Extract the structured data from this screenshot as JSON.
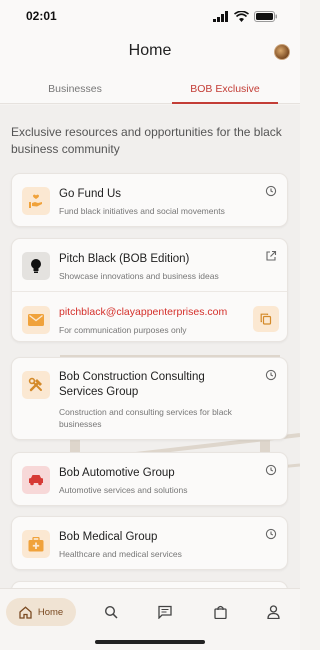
{
  "status": {
    "time": "02:01"
  },
  "header": {
    "title": "Home"
  },
  "tabs": [
    {
      "label": "Businesses",
      "active": false
    },
    {
      "label": "BOB Exclusive",
      "active": true
    }
  ],
  "intro": "Exclusive resources and opportunities for the black business community",
  "cards": {
    "gofund": {
      "title": "Go Fund Us",
      "subtitle": "Fund black initiatives and social movements",
      "icon": "hand-heart-icon"
    },
    "pitch": {
      "title": "Pitch Black (BOB Edition)",
      "subtitle": "Showcase innovations and business ideas",
      "icon": "lightbulb-icon",
      "email": "pitchblack@clayappenterprises.com",
      "email_note": "For communication purposes only"
    },
    "construction": {
      "title": "Bob Construction Consulting Services Group",
      "subtitle": "Construction and consulting services for black businesses",
      "icon": "tools-icon"
    },
    "automotive": {
      "title": "Bob Automotive Group",
      "subtitle": "Automotive services and solutions",
      "icon": "car-icon"
    },
    "medical": {
      "title": "Bob Medical Group",
      "subtitle": "Healthcare and medical services",
      "icon": "medical-kit-icon"
    }
  },
  "nav": {
    "home_label": "Home",
    "items": [
      "home-icon",
      "search-icon",
      "messages-icon",
      "bag-icon",
      "profile-icon"
    ]
  },
  "colors": {
    "accent": "#c33d36",
    "brand_brown": "#7a4a22",
    "icon_orange": "#f0a23b"
  }
}
